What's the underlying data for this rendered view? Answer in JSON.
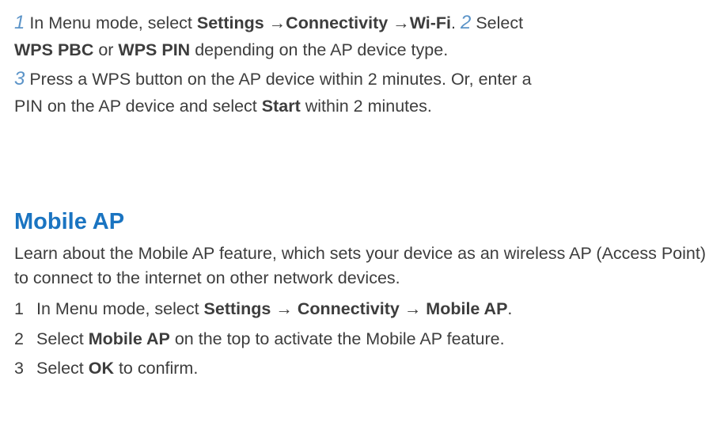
{
  "top": {
    "s1": {
      "num": "1",
      "t1": " In Menu mode, select ",
      "b1": "Settings",
      "arr1": " →",
      "b2": "Connectivity",
      "arr2": " →",
      "b3": "Wi-Fi",
      "t2": ". "
    },
    "s2": {
      "num": "2",
      "t1": " Select ",
      "b1": "WPS PBC",
      "t2": " or ",
      "b2": "WPS PIN",
      "t3": " depending on the AP device type."
    },
    "s3": {
      "num": "3",
      "t1": " Press a WPS button on the AP device within 2 minutes. Or, enter a PIN on the AP device and select ",
      "b1": "Start",
      "t2": " within 2 minutes."
    }
  },
  "heading": "Mobile AP",
  "intro": "Learn about the Mobile AP feature, which sets your device as an wireless AP (Access Point) to connect to the internet on other network devices.",
  "steps": [
    {
      "n": "1",
      "a": "In Menu mode, select ",
      "b1": "Settings",
      "arr1": " → ",
      "b2": "Connectivity",
      "arr2": " → ",
      "b3": "Mobile AP",
      "z": "."
    },
    {
      "n": "2",
      "a": "Select ",
      "b1": "Mobile AP",
      "z": " on the top to activate the Mobile AP feature."
    },
    {
      "n": "3",
      "a": "Select ",
      "b1": "OK",
      "z": " to confirm."
    }
  ]
}
